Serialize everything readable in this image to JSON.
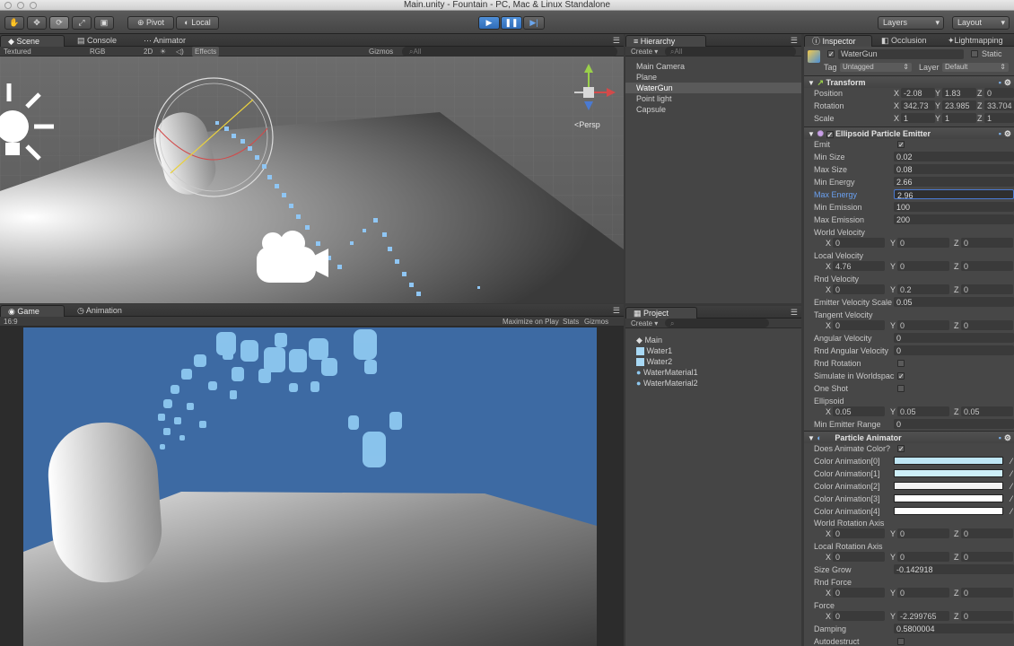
{
  "window": {
    "title": "Main.unity - Fountain - PC, Mac & Linux Standalone"
  },
  "toolbar": {
    "pivot": "Pivot",
    "local": "Local",
    "layers": "Layers",
    "layout": "Layout"
  },
  "scene": {
    "tabs": [
      "Scene",
      "Console",
      "Animator"
    ],
    "shading": "Textured",
    "rgb": "RGB",
    "mode2d": "2D",
    "effects": "Effects",
    "gizmos": "Gizmos",
    "search": "All",
    "persp": "Persp"
  },
  "game": {
    "tabs": [
      "Game",
      "Animation"
    ],
    "aspect": "16:9",
    "maximize": "Maximize on Play",
    "stats": "Stats",
    "gizmos": "Gizmos",
    "sky_color": "#3d6aa3"
  },
  "hierarchy": {
    "tab": "Hierarchy",
    "create": "Create",
    "search": "All",
    "items": [
      "Main Camera",
      "Plane",
      "WaterGun",
      "Point light",
      "Capsule"
    ],
    "selected": "WaterGun"
  },
  "project": {
    "tab": "Project",
    "create": "Create",
    "items": [
      "Main",
      "Water1",
      "Water2",
      "WaterMaterial1",
      "WaterMaterial2"
    ]
  },
  "inspector": {
    "tabs": [
      "Inspector",
      "Occlusion",
      "Lightmapping"
    ],
    "object_name": "WaterGun",
    "static": "Static",
    "tag_label": "Tag",
    "tag": "Untagged",
    "layer_label": "Layer",
    "layer": "Default",
    "transform": {
      "title": "Transform",
      "position": {
        "label": "Position",
        "x": "-2.08",
        "y": "1.83",
        "z": "0"
      },
      "rotation": {
        "label": "Rotation",
        "x": "342.73",
        "y": "23.985",
        "z": "33.704"
      },
      "scale": {
        "label": "Scale",
        "x": "1",
        "y": "1",
        "z": "1"
      }
    },
    "emitter": {
      "title": "Ellipsoid Particle Emitter",
      "emit": "Emit",
      "min_size": {
        "label": "Min Size",
        "value": "0.02"
      },
      "max_size": {
        "label": "Max Size",
        "value": "0.08"
      },
      "min_energy": {
        "label": "Min Energy",
        "value": "2.66"
      },
      "max_energy": {
        "label": "Max Energy",
        "value": "2.96"
      },
      "min_emission": {
        "label": "Min Emission",
        "value": "100"
      },
      "max_emission": {
        "label": "Max Emission",
        "value": "200"
      },
      "world_velocity": {
        "label": "World Velocity",
        "x": "0",
        "y": "0",
        "z": "0"
      },
      "local_velocity": {
        "label": "Local Velocity",
        "x": "4.76",
        "y": "0",
        "z": "0"
      },
      "rnd_velocity": {
        "label": "Rnd Velocity",
        "x": "0",
        "y": "0.2",
        "z": "0"
      },
      "emitter_velocity_scale": {
        "label": "Emitter Velocity Scale",
        "value": "0.05"
      },
      "tangent_velocity": {
        "label": "Tangent Velocity",
        "x": "0",
        "y": "0",
        "z": "0"
      },
      "angular_velocity": {
        "label": "Angular Velocity",
        "value": "0"
      },
      "rnd_angular_velocity": {
        "label": "Rnd Angular Velocity",
        "value": "0"
      },
      "rnd_rotation": "Rnd Rotation",
      "simulate_world": "Simulate in Worldspac",
      "one_shot": "One Shot",
      "ellipsoid": {
        "label": "Ellipsoid",
        "x": "0.05",
        "y": "0.05",
        "z": "0.05"
      },
      "min_emitter_range": {
        "label": "Min Emitter Range",
        "value": "0"
      }
    },
    "animator": {
      "title": "Particle Animator",
      "does_animate": "Does Animate Color?",
      "colors": [
        {
          "label": "Color Animation[0]",
          "color": "#bfe6f5"
        },
        {
          "label": "Color Animation[1]",
          "color": "#cdeef8"
        },
        {
          "label": "Color Animation[2]",
          "color": "#f2f2f2"
        },
        {
          "label": "Color Animation[3]",
          "color": "#ffffff"
        },
        {
          "label": "Color Animation[4]",
          "color": "#ffffff"
        }
      ],
      "world_rotation_axis": {
        "label": "World Rotation Axis",
        "x": "0",
        "y": "0",
        "z": "0"
      },
      "local_rotation_axis": {
        "label": "Local Rotation Axis",
        "x": "0",
        "y": "0",
        "z": "0"
      },
      "size_grow": {
        "label": "Size Grow",
        "value": "-0.142918"
      },
      "rnd_force": {
        "label": "Rnd Force",
        "x": "0",
        "y": "0",
        "z": "0"
      },
      "force": {
        "label": "Force",
        "x": "0",
        "y": "-2.299765",
        "z": "0"
      },
      "damping": {
        "label": "Damping",
        "value": "0.5800004"
      },
      "autodestruct": "Autodestruct"
    }
  }
}
